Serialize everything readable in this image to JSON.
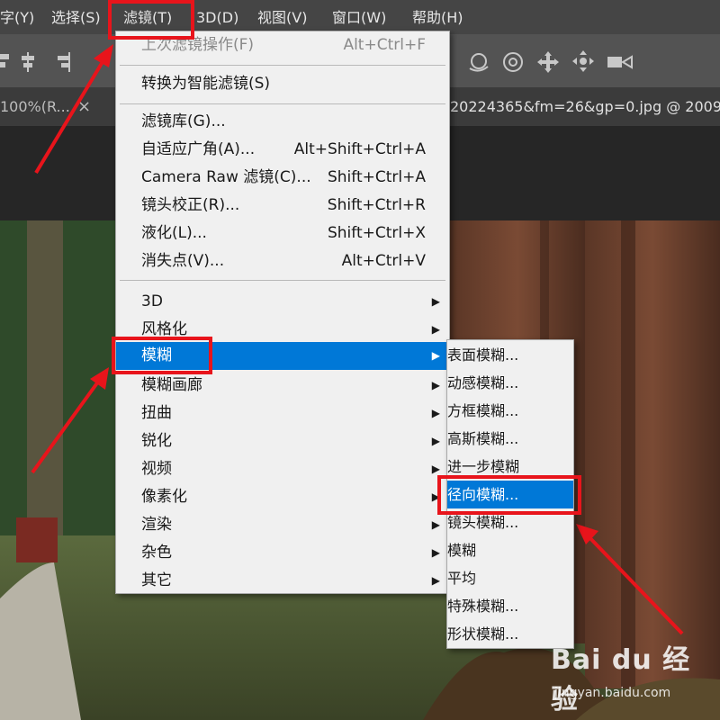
{
  "menubar": {
    "items": [
      "字(Y)",
      "选择(S)",
      "滤镜(T)",
      "3D(D)",
      "视图(V)",
      "窗口(W)",
      "帮助(H)"
    ]
  },
  "doc_tabs": {
    "left_tab": "100%(R...",
    "close": "×",
    "right_tab": "20224365&fm=26&gp=0.jpg @ 2009"
  },
  "filter_menu": {
    "items": [
      {
        "label": "上次滤镜操作(F)",
        "shortcut": "Alt+Ctrl+F"
      },
      {
        "label": "转换为智能滤镜(S)",
        "shortcut": ""
      },
      {
        "label": "滤镜库(G)...",
        "shortcut": ""
      },
      {
        "label": "自适应广角(A)...",
        "shortcut": "Alt+Shift+Ctrl+A"
      },
      {
        "label": "Camera Raw 滤镜(C)...",
        "shortcut": "Shift+Ctrl+A"
      },
      {
        "label": "镜头校正(R)...",
        "shortcut": "Shift+Ctrl+R"
      },
      {
        "label": "液化(L)...",
        "shortcut": "Shift+Ctrl+X"
      },
      {
        "label": "消失点(V)...",
        "shortcut": "Alt+Ctrl+V"
      },
      {
        "label": "3D"
      },
      {
        "label": "风格化"
      },
      {
        "label": "模糊"
      },
      {
        "label": "模糊画廊"
      },
      {
        "label": "扭曲"
      },
      {
        "label": "锐化"
      },
      {
        "label": "视频"
      },
      {
        "label": "像素化"
      },
      {
        "label": "渲染"
      },
      {
        "label": "杂色"
      },
      {
        "label": "其它"
      }
    ]
  },
  "blur_submenu": {
    "items": [
      "表面模糊...",
      "动感模糊...",
      "方框模糊...",
      "高斯模糊...",
      "进一步模糊",
      "径向模糊...",
      "镜头模糊...",
      "模糊",
      "平均",
      "特殊模糊...",
      "形状模糊..."
    ]
  },
  "watermark": {
    "logo": "Bai du 经验",
    "url": "jingyan.baidu.com"
  },
  "colors": {
    "highlight": "#0078d7",
    "annotation_red": "#e8141b"
  }
}
